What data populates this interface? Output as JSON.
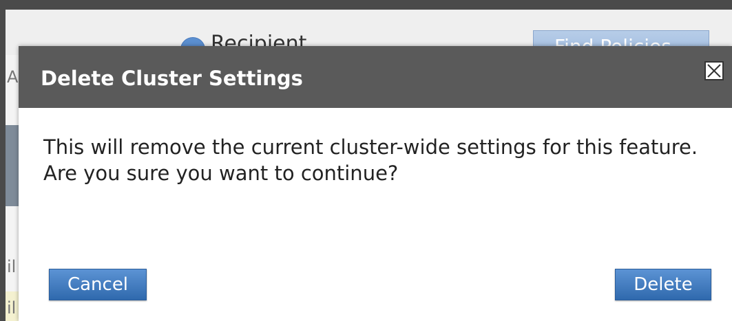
{
  "background": {
    "recipient_label": "Recipient",
    "find_policies_label": "Find Policies",
    "left_glyphs": [
      "A",
      "il",
      "il"
    ]
  },
  "dialog": {
    "title": "Delete Cluster Settings",
    "close_icon": "close-icon",
    "message_line1": "This will remove the current cluster-wide settings for this feature.",
    "message_line2": "Are you sure you want to continue?",
    "cancel_label": "Cancel",
    "delete_label": "Delete"
  },
  "colors": {
    "header": "#5a5a5a",
    "button": "#3d77bd",
    "dialog_bg": "#ffffff"
  }
}
